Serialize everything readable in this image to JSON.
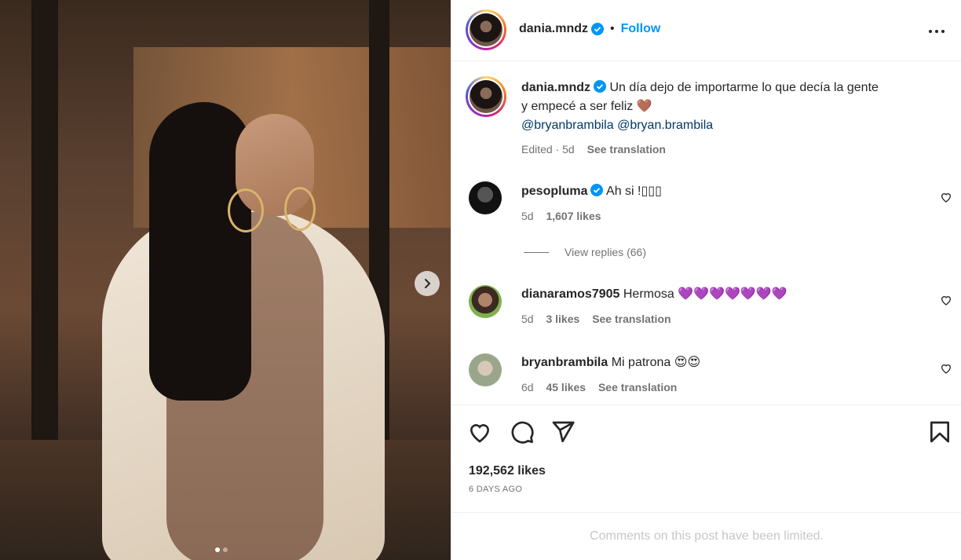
{
  "post": {
    "author": "dania.mndz",
    "follow_label": "Follow",
    "separator": "•",
    "caption_line1": "Un día dejo de importarme lo que decía la gente",
    "caption_line2": "y empecé a ser feliz 🤎",
    "mention1": "@bryanbrambila",
    "mention2": "@bryan.brambila",
    "caption_meta_edited": "Edited · 5d",
    "see_translation": "See translation",
    "likes": "192,562 likes",
    "date": "6 DAYS AGO",
    "comments_limited": "Comments on this post have been limited."
  },
  "comments": [
    {
      "user": "pesopluma",
      "text": "Ah si !▯▯▯",
      "age": "5d",
      "likes": "1,607 likes",
      "view_replies": "View replies (66)"
    },
    {
      "user": "dianaramos7905",
      "text": "Hermosa 💜💜💜💜💜💜💜",
      "age": "5d",
      "likes": "3 likes",
      "translation": "See translation"
    },
    {
      "user": "bryanbrambila",
      "text": "Mi patrona 😍😍",
      "age": "6d",
      "likes": "45 likes",
      "translation": "See translation"
    }
  ],
  "media": {
    "slide_index": 1,
    "slide_count": 2
  },
  "colors": {
    "accent": "#0095f6",
    "verified": "#0095f6",
    "text": "#262626",
    "muted": "#737373"
  },
  "icons": [
    "verified-icon",
    "more-icon",
    "heart-icon",
    "comment-icon",
    "share-icon",
    "bookmark-icon",
    "chevron-right-icon"
  ]
}
